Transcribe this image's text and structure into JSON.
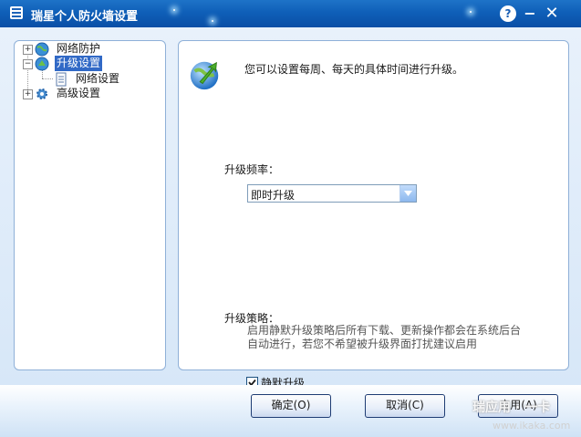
{
  "window": {
    "title": "瑞星个人防火墙设置",
    "help_glyph": "?",
    "minimize_glyph": "−",
    "close_glyph": "✕"
  },
  "tree": {
    "items": [
      {
        "label": "网络防护",
        "toggle": "+"
      },
      {
        "label": "升级设置",
        "toggle": "−",
        "selected": true
      },
      {
        "label": "网络设置"
      },
      {
        "label": "高级设置",
        "toggle": "+"
      }
    ]
  },
  "content": {
    "description": "您可以设置每周、每天的具体时间进行升级。",
    "frequency_label": "升级频率：",
    "frequency_value": "即时升级",
    "policy_label": "升级策略：",
    "policy_text_line1": "启用静默升级策略后所有下载、更新操作都会在系统后台",
    "policy_text_line2": "自动进行，若您不希望被升级界面打扰建议启用",
    "silent_upgrade_label": "静默升级",
    "silent_upgrade_checked": true
  },
  "buttons": {
    "ok": "确定(O)",
    "cancel": "取消(C)",
    "apply": "应用(A)"
  },
  "watermark": {
    "brand": "瑞应用 · 一卡",
    "url": "www.ikaka.com"
  },
  "colors": {
    "titlebar": "#0f5fb8",
    "selection": "#3169c6",
    "panel_border": "#8fb0d8"
  }
}
